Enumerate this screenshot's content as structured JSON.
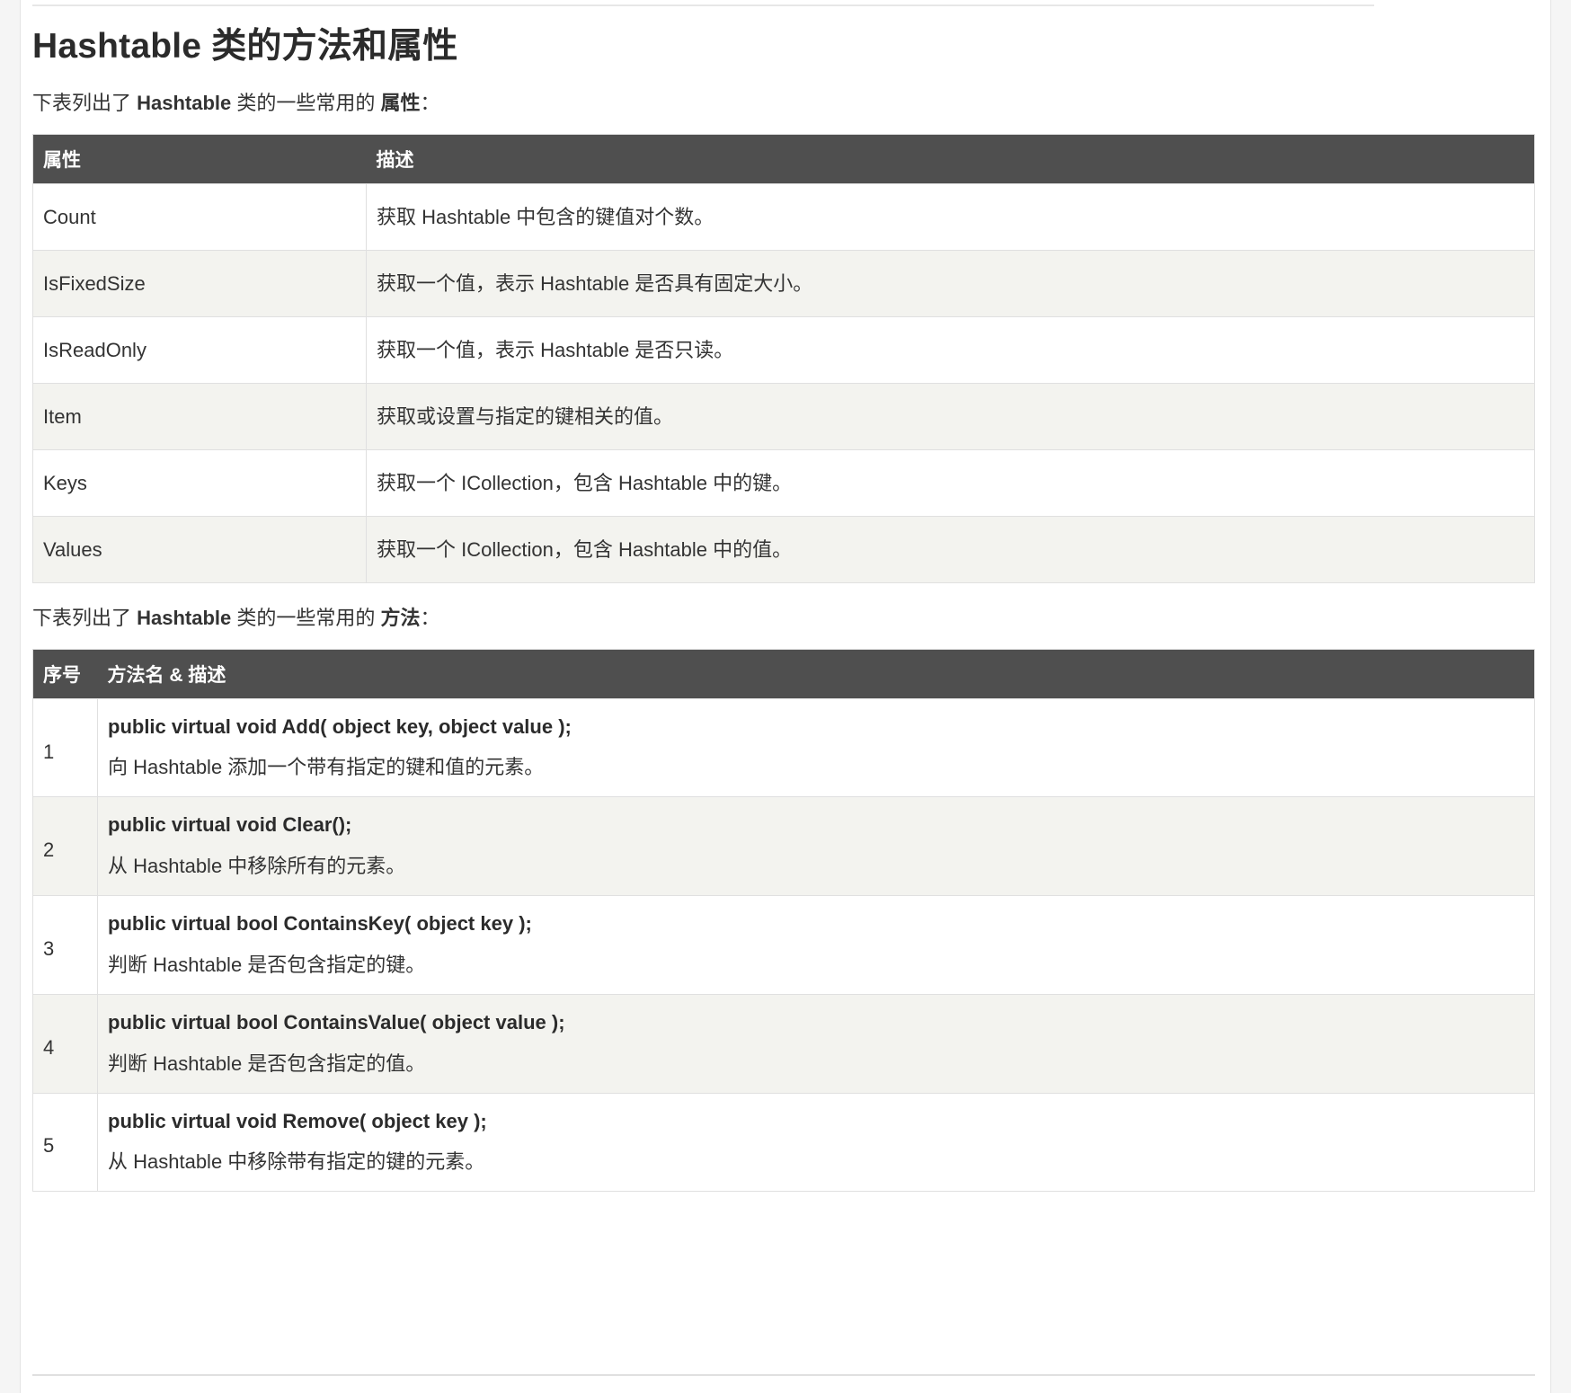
{
  "page": {
    "title": "Hashtable 类的方法和属性",
    "properties_intro_prefix": "下表列出了 ",
    "properties_intro_strong": "Hashtable",
    "properties_intro_middle": " 类的一些常用的 ",
    "properties_intro_strong2": "属性",
    "properties_intro_suffix": "：",
    "methods_intro_prefix": "下表列出了 ",
    "methods_intro_strong": "Hashtable",
    "methods_intro_middle": " 类的一些常用的 ",
    "methods_intro_strong2": "方法",
    "methods_intro_suffix": "："
  },
  "properties_table": {
    "headers": [
      "属性",
      "描述"
    ],
    "rows": [
      {
        "name": "Count",
        "desc": "获取 Hashtable 中包含的键值对个数。"
      },
      {
        "name": "IsFixedSize",
        "desc": "获取一个值，表示 Hashtable 是否具有固定大小。"
      },
      {
        "name": "IsReadOnly",
        "desc": "获取一个值，表示 Hashtable 是否只读。"
      },
      {
        "name": "Item",
        "desc": "获取或设置与指定的键相关的值。"
      },
      {
        "name": "Keys",
        "desc": "获取一个 ICollection，包含 Hashtable 中的键。"
      },
      {
        "name": "Values",
        "desc": "获取一个 ICollection，包含 Hashtable 中的值。"
      }
    ]
  },
  "methods_table": {
    "headers": [
      "序号",
      "方法名 & 描述"
    ],
    "rows": [
      {
        "index": "1",
        "signature": "public virtual void Add( object key, object value );",
        "desc": "向 Hashtable 添加一个带有指定的键和值的元素。"
      },
      {
        "index": "2",
        "signature": "public virtual void Clear();",
        "desc": "从 Hashtable 中移除所有的元素。"
      },
      {
        "index": "3",
        "signature": "public virtual bool ContainsKey( object key );",
        "desc": "判断 Hashtable 是否包含指定的键。"
      },
      {
        "index": "4",
        "signature": "public virtual bool ContainsValue( object value );",
        "desc": "判断 Hashtable 是否包含指定的值。"
      },
      {
        "index": "5",
        "signature": "public virtual void Remove( object key );",
        "desc": "从 Hashtable 中移除带有指定的键的元素。"
      }
    ]
  },
  "colors": {
    "table_header_bg": "#4f4f4f",
    "table_header_text": "#ffffff",
    "row_alt_bg": "#f3f3ef",
    "body_text": "#333333",
    "border": "#e0e0e0"
  }
}
